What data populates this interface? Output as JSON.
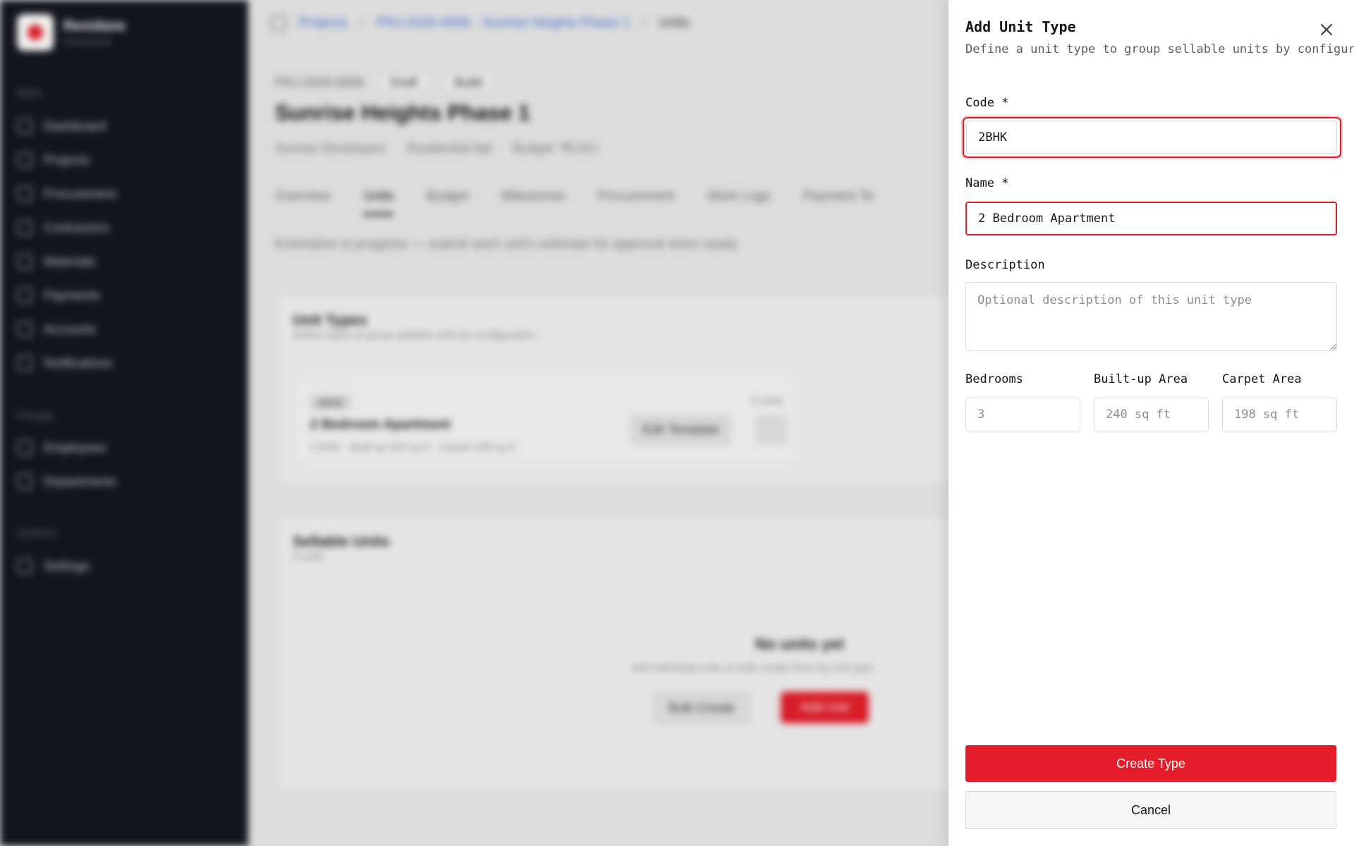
{
  "sidebar": {
    "brand_name": "Residaxe",
    "brand_sub": "Construction",
    "groups": {
      "main": "Main",
      "people": "People",
      "system": "System"
    },
    "items": [
      {
        "label": "Dashboard",
        "icon": "grid-icon"
      },
      {
        "label": "Projects",
        "icon": "folder-icon"
      },
      {
        "label": "Procurement",
        "icon": "cart-icon"
      },
      {
        "label": "Contractors",
        "icon": "users-icon"
      },
      {
        "label": "Materials",
        "icon": "box-icon"
      },
      {
        "label": "Payments",
        "icon": "card-icon"
      },
      {
        "label": "Accounts",
        "icon": "ledger-icon"
      },
      {
        "label": "Notifications",
        "icon": "bell-icon"
      },
      {
        "label": "Employees",
        "icon": "person-icon"
      },
      {
        "label": "Departments",
        "icon": "building-icon"
      },
      {
        "label": "Settings",
        "icon": "gear-icon"
      }
    ]
  },
  "main": {
    "breadcrumbs": [
      "Projects",
      "PRJ-2026-0006 · Sunrise Heights Phase 1",
      "Units"
    ],
    "project_code": "PRJ-2026-0006",
    "status_pill": "Draft",
    "status_pill_2": "Build",
    "project_title": "Sunrise Heights Phase 1",
    "client": "Sunrise Developers",
    "category": "Residential Apt",
    "budget": "Budget: ₹6.5Cr",
    "tabs": [
      "Overview",
      "Units",
      "Budget",
      "Milestones",
      "Procurement",
      "Work Logs",
      "Payment Te"
    ],
    "banner": "Estimation in progress — submit each unit's estimate for approval when ready.",
    "unit_types": {
      "title": "Unit Types",
      "subtitle": "Define types to group sellable units by configuration.",
      "row": {
        "chip": "2BHK",
        "count": "0 units",
        "name": "2 Bedroom Apartment",
        "detail": "2 BHK · Built-up 240 sq ft · Carpet 198 sq ft",
        "edit_template": "Edit Template"
      }
    },
    "sellable_units": {
      "title": "Sellable Units",
      "count": "0 units",
      "empty_title": "No units yet",
      "empty_sub": "Add individual units or bulk create them by unit type.",
      "bulk_create": "Bulk Create",
      "add_unit": "Add Unit"
    }
  },
  "drawer": {
    "title": "Add Unit Type",
    "description": "Define a unit type to group sellable units by configuration.",
    "code_label": "Code *",
    "code_value": "2BHK",
    "name_label": "Name *",
    "name_value": "2 Bedroom Apartment",
    "description_label": "Description",
    "description_placeholder": "Optional description of this unit type",
    "bedrooms_label": "Bedrooms",
    "bedrooms_placeholder": "3",
    "builtup_label": "Built-up Area",
    "builtup_placeholder": "240 sq ft",
    "carpet_label": "Carpet Area",
    "carpet_placeholder": "198 sq ft",
    "create_label": "Create Type",
    "cancel_label": "Cancel"
  },
  "colors": {
    "accent": "#e51d2a",
    "sidebar_bg": "#14161f",
    "error_border": "#e11d2a"
  }
}
